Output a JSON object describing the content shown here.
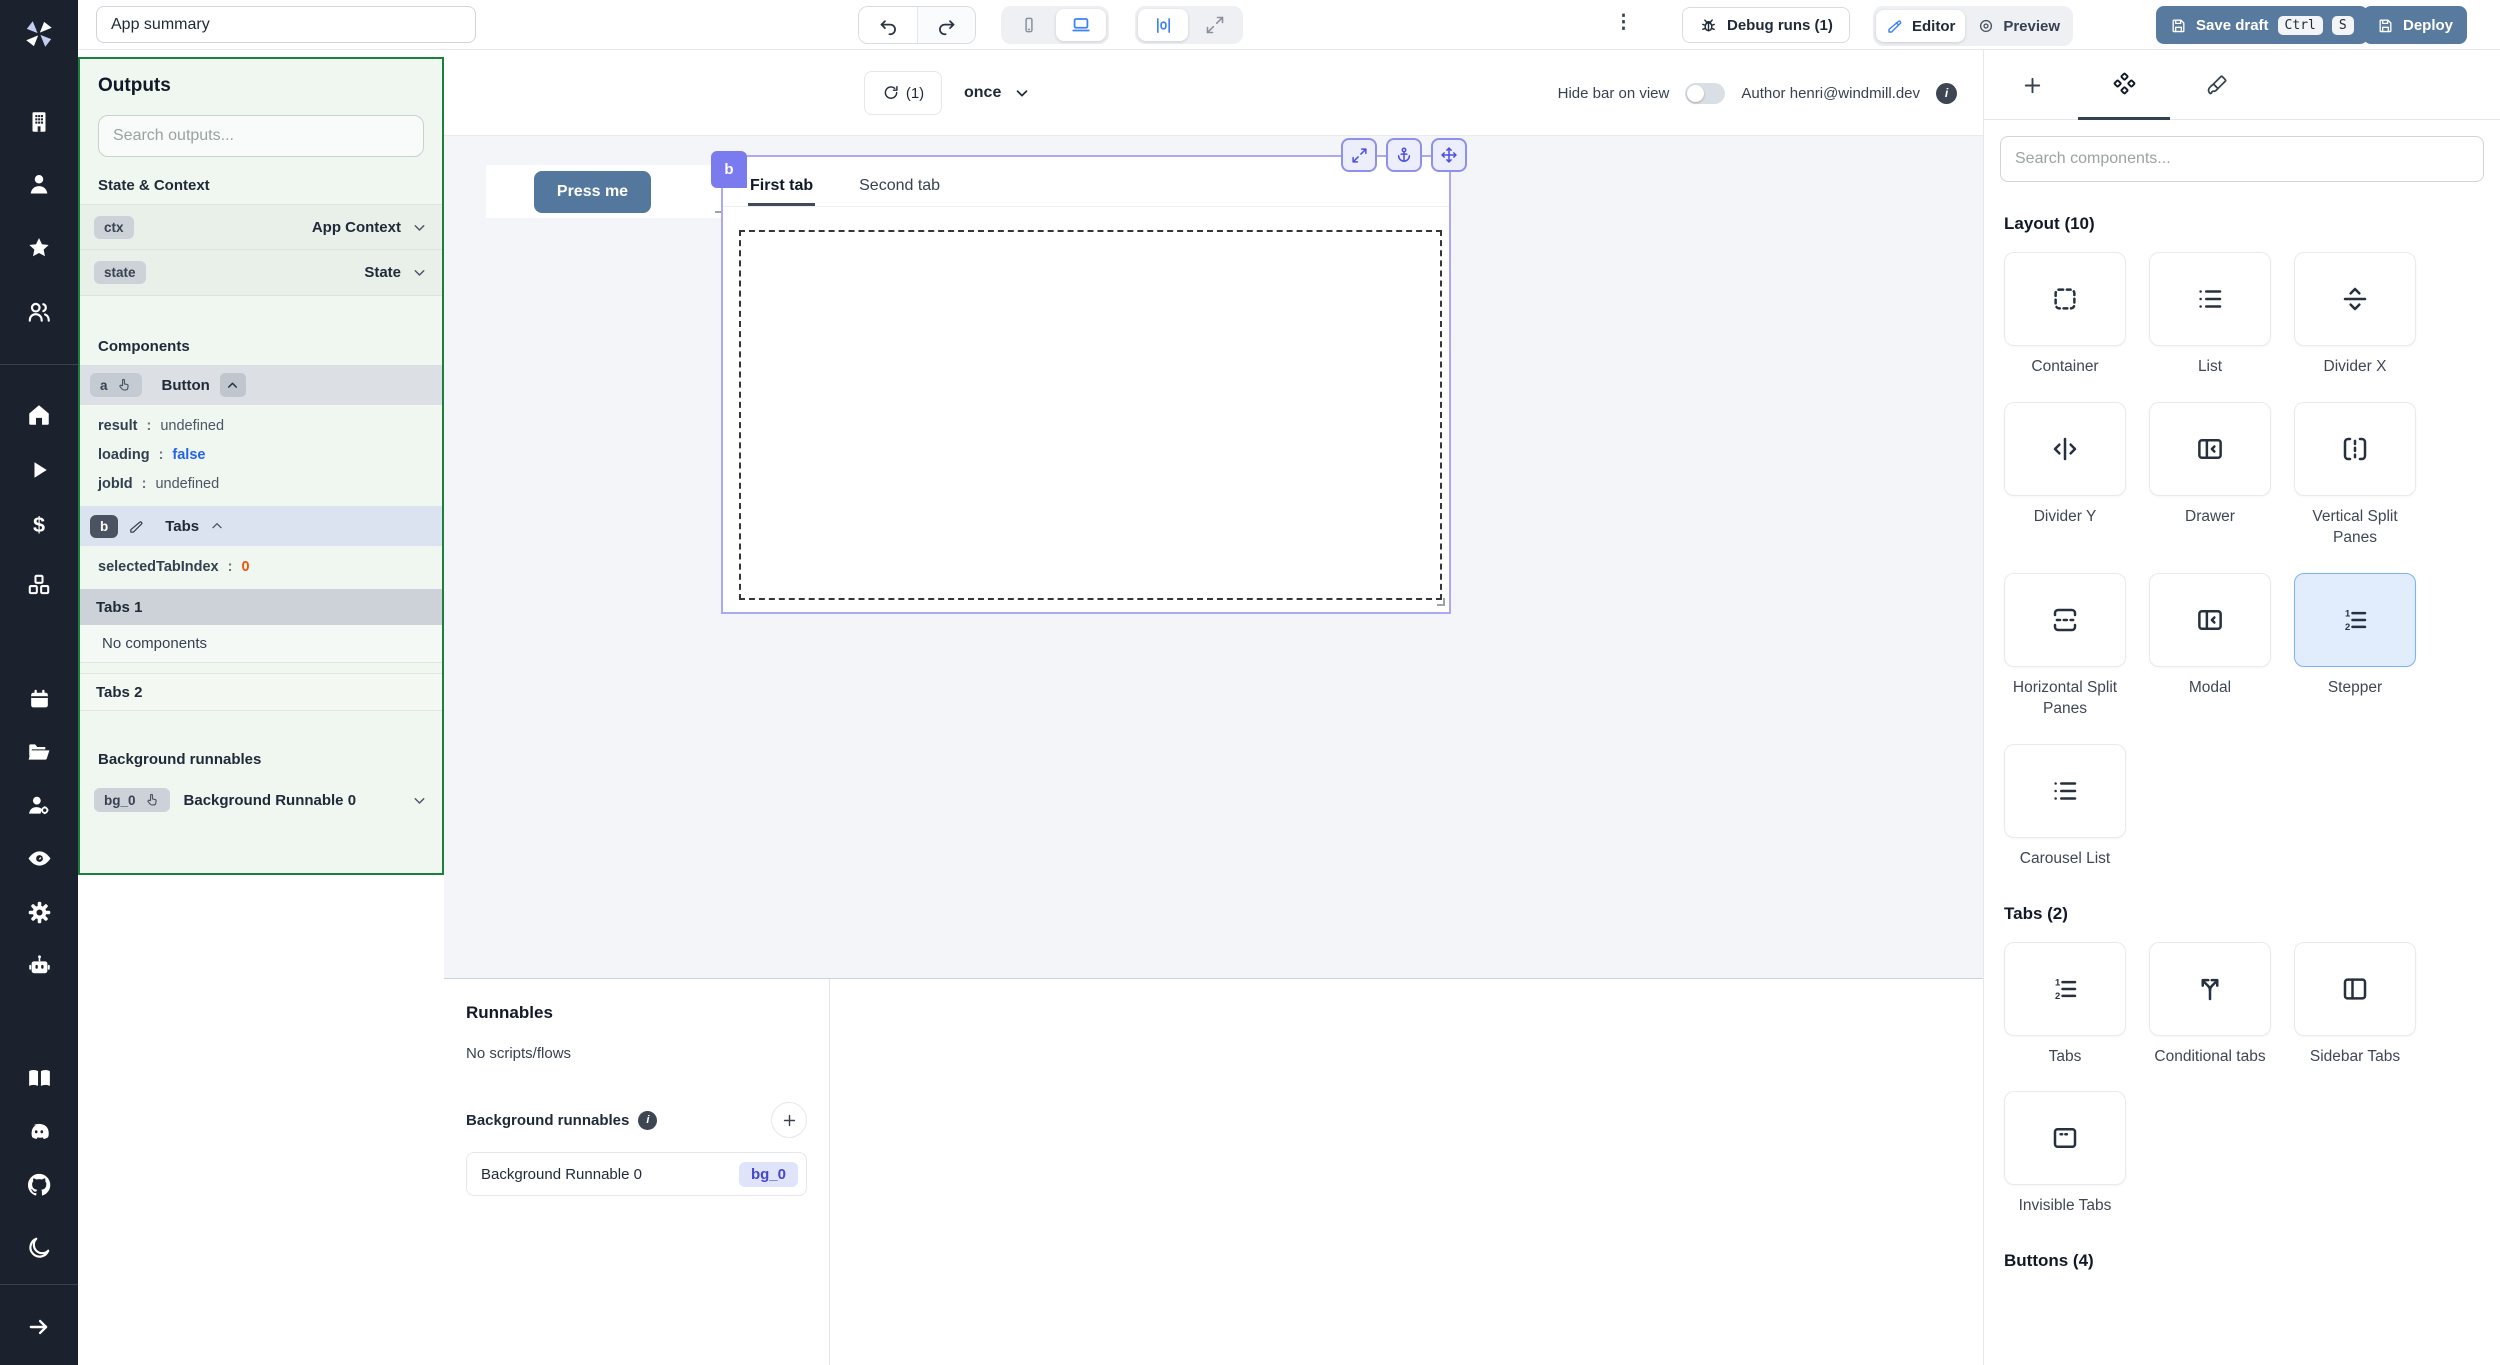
{
  "topbar": {
    "app_summary": "App summary",
    "debug_runs": "Debug runs (1)",
    "editor": "Editor",
    "preview": "Preview",
    "save_draft": "Save draft",
    "kbd_ctrl": "Ctrl",
    "kbd_s": "S",
    "deploy": "Deploy",
    "kebab": "⋮"
  },
  "canvas_toolbar": {
    "refresh_count": "(1)",
    "frequency": "once",
    "hide_bar_label": "Hide bar on view",
    "author": "Author henri@windmill.dev",
    "info": "i"
  },
  "outputs_panel": {
    "title": "Outputs",
    "search_placeholder": "Search outputs...",
    "state_context_heading": "State & Context",
    "ctx": {
      "id": "ctx",
      "label": "App Context"
    },
    "state": {
      "id": "state",
      "label": "State"
    },
    "components_heading": "Components",
    "component_a": {
      "id": "a",
      "type": "Button",
      "props": [
        {
          "key": "result",
          "value": "undefined"
        },
        {
          "key": "loading",
          "value": "false"
        },
        {
          "key": "jobId",
          "value": "undefined"
        }
      ]
    },
    "component_b": {
      "id": "b",
      "type": "Tabs",
      "props": [
        {
          "key": "selectedTabIndex",
          "value": "0"
        }
      ],
      "tab1_label": "Tabs 1",
      "tab1_content": "No components",
      "tab2_label": "Tabs 2"
    },
    "background_heading": "Background runnables",
    "bg0": {
      "id": "bg_0",
      "label": "Background Runnable 0"
    }
  },
  "canvas": {
    "button_label": "Press me",
    "tabs_component": {
      "id": "b",
      "tab1": "First tab",
      "tab2": "Second tab"
    }
  },
  "runnables_panel": {
    "title": "Runnables",
    "empty": "No scripts/flows",
    "background_heading": "Background runnables",
    "row_label": "Background Runnable 0",
    "row_badge": "bg_0"
  },
  "components_panel": {
    "search_placeholder": "Search components...",
    "layout_heading": "Layout (10)",
    "tabs_heading": "Tabs (2)",
    "buttons_heading": "Buttons (4)",
    "items": {
      "container": "Container",
      "list": "List",
      "divider_x": "Divider X",
      "divider_y": "Divider Y",
      "drawer": "Drawer",
      "vertical_split": "Vertical Split Panes",
      "horizontal_split": "Horizontal Split Panes",
      "modal": "Modal",
      "stepper": "Stepper",
      "carousel": "Carousel List",
      "tabs": "Tabs",
      "conditional_tabs": "Conditional tabs",
      "sidebar_tabs": "Sidebar Tabs",
      "invisible_tabs": "Invisible Tabs"
    }
  },
  "colors": {
    "accent_slate_blue": "#587a9f",
    "selection_indigo": "#7b7bf0",
    "outputs_green_border": "#1b7f3d",
    "value_blue": "#2563eb",
    "value_orange": "#ea580c",
    "selected_card_blue": "#7fb1f7"
  }
}
